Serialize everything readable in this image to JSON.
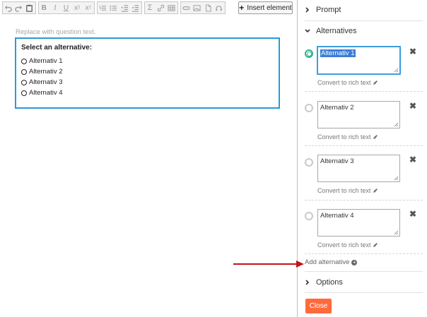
{
  "toolbar": {
    "insert_label": "Insert element",
    "buttons": [
      "undo",
      "redo",
      "paste",
      "bold",
      "italic",
      "underline",
      "subscript",
      "superscript",
      "ordered-list",
      "bullet-list",
      "indent",
      "outdent",
      "math",
      "link",
      "table",
      "line",
      "image",
      "document",
      "audio"
    ]
  },
  "editor": {
    "placeholder": "Replace with question text.",
    "select_title": "Select an alternative:",
    "options": [
      "Alternativ 1",
      "Alternativ 2",
      "Alternativ 3",
      "Alternativ 4"
    ],
    "border_color": "#2a9ad6"
  },
  "panel": {
    "prompt_label": "Prompt",
    "alternatives_label": "Alternatives",
    "options_label": "Options",
    "convert_label": "Convert to rich text",
    "add_label": "Add alternative",
    "close_label": "Close",
    "close_color": "#ff6a3d",
    "selected_color": "#2bb38f",
    "alternatives": [
      {
        "value": "Alternativ 1",
        "selected": true
      },
      {
        "value": "Alternativ 2",
        "selected": false
      },
      {
        "value": "Alternativ 3",
        "selected": false
      },
      {
        "value": "Alternativ 4",
        "selected": false
      }
    ]
  },
  "annotation": {
    "arrow_color": "#c0141a"
  }
}
